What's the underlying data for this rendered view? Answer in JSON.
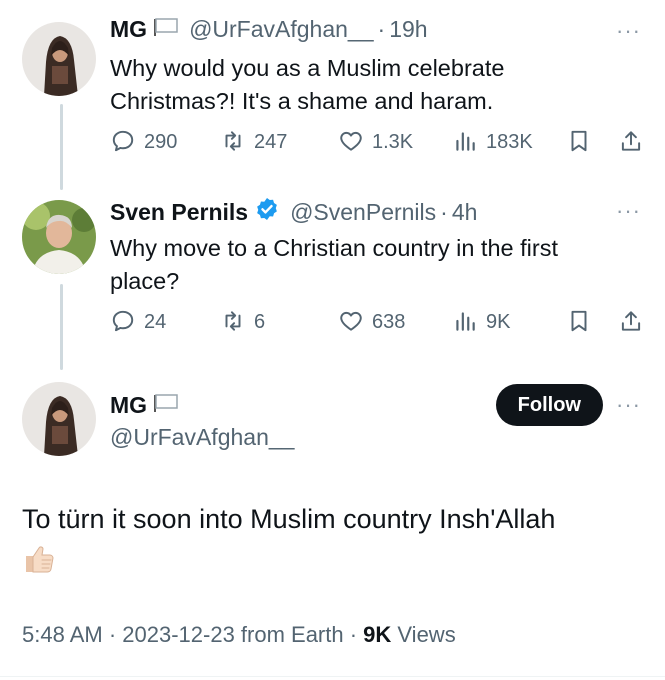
{
  "tweets": [
    {
      "name": "MG",
      "handle": "@UrFavAfghan__",
      "time": "19h",
      "text_lines": [
        "Why would you as a Muslim celebrate",
        "Christmas?! It's a shame and haram."
      ],
      "replies": "290",
      "reposts": "247",
      "likes": "1.3K",
      "views": "183K"
    },
    {
      "name": "Sven Pernils",
      "handle": "@SvenPernils",
      "time": "4h",
      "verified": true,
      "text_lines": [
        "Why move to a Christian country in the first",
        "place?"
      ],
      "replies": "24",
      "reposts": "6",
      "likes": "638",
      "views": "9K"
    }
  ],
  "main": {
    "name": "MG",
    "handle": "@UrFavAfghan__",
    "follow_label": "Follow",
    "text": "To türn it soon into Muslim country Insh'Allah",
    "meta_prefix": "5:48 AM · 2023-12-23 from Earth · ",
    "views_count": "9K",
    "views_label": " Views"
  },
  "icons": {
    "more": "more-horizontal-icon",
    "reply": "reply-bubble-icon",
    "repost": "repost-icon",
    "like": "heart-icon",
    "views": "bar-chart-icon",
    "bookmark": "bookmark-icon",
    "share": "share-icon",
    "flag": "white-flag-icon",
    "verified": "verified-badge-icon",
    "thumb": "thumbs-up-emoji"
  },
  "colors": {
    "text": "#0f1419",
    "secondary": "#536471",
    "verified": "#1d9bf0",
    "follow_bg": "#0f1419"
  }
}
